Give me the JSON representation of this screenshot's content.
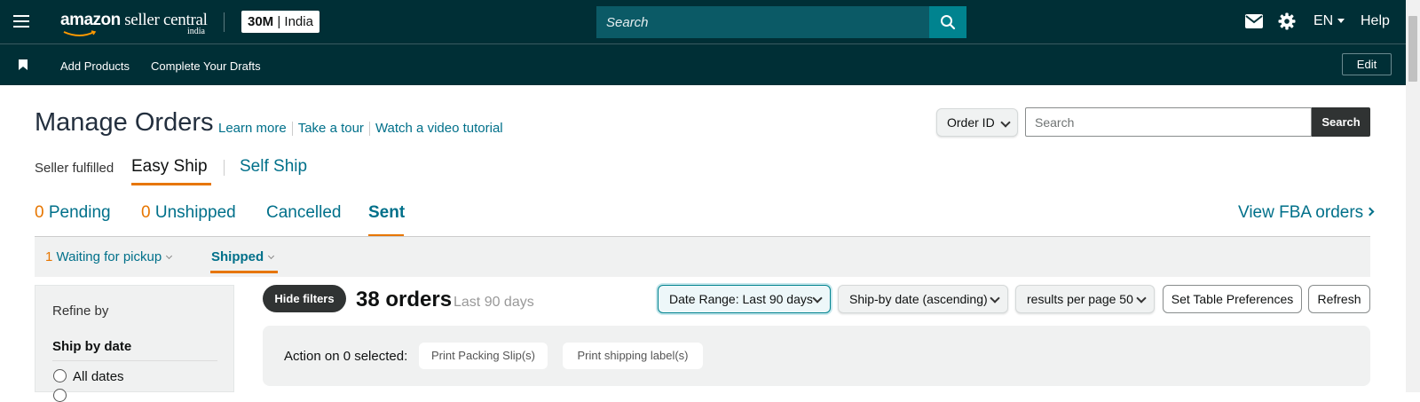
{
  "header": {
    "logo_text": "amazon",
    "logo_text_2": "seller central",
    "logo_sub": "india",
    "store": {
      "id": "30M",
      "region": "India"
    },
    "search_placeholder": "Search",
    "language": "EN",
    "help": "Help"
  },
  "nav": {
    "links": [
      "Add Products",
      "Complete Your Drafts"
    ],
    "edit": "Edit"
  },
  "page": {
    "title": "Manage Orders",
    "links": [
      "Learn more",
      "Take a tour",
      "Watch a video tutorial"
    ],
    "order_filter": {
      "selected": "Order ID"
    },
    "search_placeholder": "Search",
    "search_button": "Search"
  },
  "fulfillment": {
    "label": "Seller fulfilled",
    "tabs": [
      "Easy Ship",
      "Self Ship"
    ],
    "active": "Easy Ship"
  },
  "status_tabs": [
    {
      "count": "0",
      "label": "Pending"
    },
    {
      "count": "0",
      "label": "Unshipped"
    },
    {
      "count": "",
      "label": "Cancelled"
    },
    {
      "count": "",
      "label": "Sent"
    }
  ],
  "active_status": "Sent",
  "view_fba": "View FBA orders",
  "sub_tabs": [
    {
      "count": "1",
      "label": "Waiting for pickup"
    },
    {
      "count": "",
      "label": "Shipped"
    }
  ],
  "active_sub_tab": "Shipped",
  "refine": {
    "title": "Refine by",
    "ship_by_date": "Ship by date",
    "options": [
      "All dates"
    ]
  },
  "results": {
    "hide_filters": "Hide filters",
    "count": "38 orders",
    "range": "Last 90 days",
    "date_range": "Date Range: Last 90 days",
    "sort": "Ship-by date (ascending)",
    "per_page": "results per page 50",
    "set_table_prefs": "Set Table Preferences",
    "refresh": "Refresh"
  },
  "actions": {
    "label": "Action on 0 selected:",
    "buttons": [
      "Print Packing Slip(s)",
      "Print shipping label(s)"
    ]
  },
  "colors": {
    "header_bg": "#002f36",
    "accent_orange": "#e77600",
    "link_teal": "#00708a",
    "search_button": "#00838f"
  }
}
